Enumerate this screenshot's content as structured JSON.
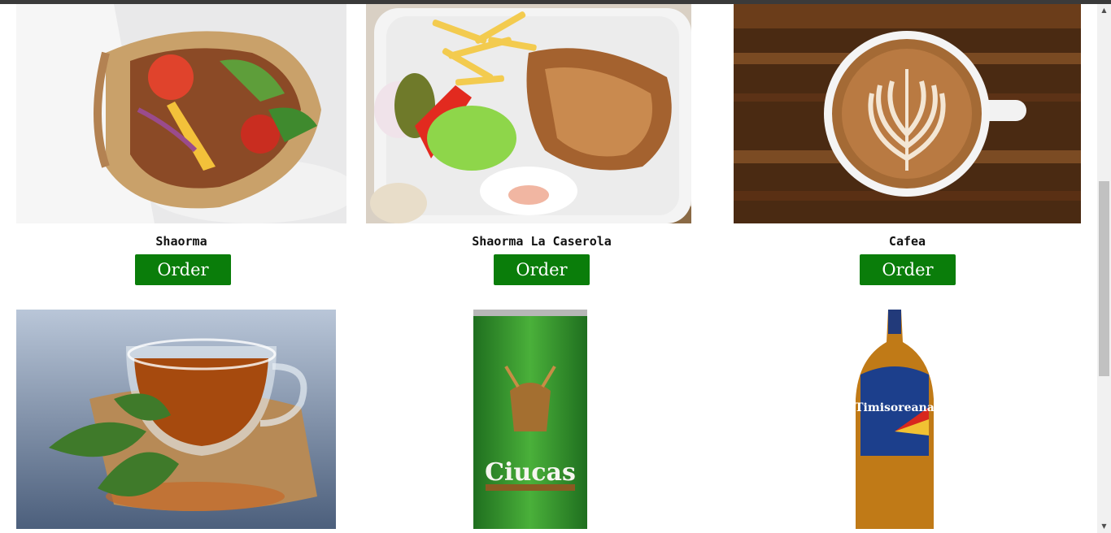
{
  "products": [
    {
      "name": "Shaorma",
      "button": "Order",
      "image": "shaorma-wrap-photo"
    },
    {
      "name": "Shaorma La Caserola",
      "button": "Order",
      "image": "shaorma-plate-photo"
    },
    {
      "name": "Cafea",
      "button": "Order",
      "image": "coffee-latte-photo"
    },
    {
      "image": "tea-cup-photo"
    },
    {
      "image": "ciucas-beer-can-photo",
      "image_text": "Ciucas"
    },
    {
      "image": "timisoreana-beer-bottle-photo",
      "image_text": "Timisoreana"
    }
  ],
  "colors": {
    "order_button": "#0a7d0a",
    "topbar": "#3a3a3a"
  },
  "scrollbar": {
    "up_icon": "triangle-up",
    "down_icon": "triangle-down"
  }
}
